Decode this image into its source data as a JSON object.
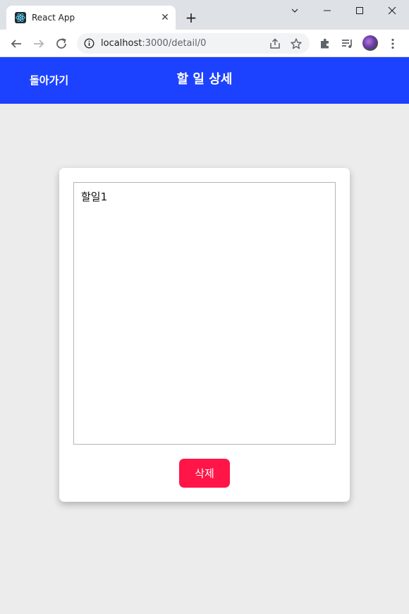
{
  "browser": {
    "tab_title": "React App",
    "tab_close_glyph": "✕",
    "new_tab_glyph": "+",
    "url_host": "localhost",
    "url_path": ":3000/detail/0",
    "icons": [
      "react-favicon-icon",
      "back-arrow-icon",
      "forward-arrow-icon",
      "reload-icon",
      "site-info-icon",
      "share-icon",
      "bookmark-star-icon",
      "extensions-icon",
      "media-queue-icon",
      "profile-avatar",
      "kebab-menu-icon",
      "chevron-down-icon",
      "minimize-icon",
      "maximize-icon",
      "window-close-icon"
    ]
  },
  "header": {
    "back_label": "돌아가기",
    "title": "할 일 상세"
  },
  "detail": {
    "todo_text": "할일1",
    "delete_label": "삭제"
  },
  "colors": {
    "header_bg": "#1c42ff",
    "delete_bg": "#ff1547",
    "page_bg": "#ececec"
  }
}
